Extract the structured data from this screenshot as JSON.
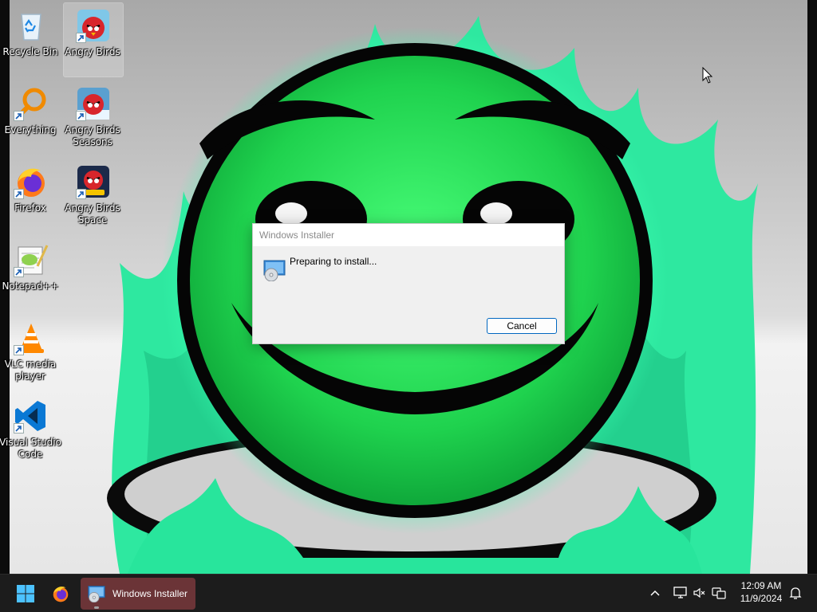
{
  "desktop": {
    "icons": [
      {
        "label": "Recycle Bin",
        "icon": "recycle-bin-icon"
      },
      {
        "label": "Angry Birds",
        "icon": "angry-birds-icon",
        "selected": true
      },
      {
        "label": "Everything",
        "icon": "everything-search-icon"
      },
      {
        "label": "Angry Birds Seasons",
        "icon": "angry-birds-seasons-icon"
      },
      {
        "label": "Firefox",
        "icon": "firefox-icon"
      },
      {
        "label": "Angry Birds Space",
        "icon": "angry-birds-space-icon"
      },
      {
        "label": "Notepad++",
        "icon": "notepad-plus-plus-icon"
      },
      {
        "label": "VLC media player",
        "icon": "vlc-icon"
      },
      {
        "label": "Visual Studio Code",
        "icon": "vscode-icon"
      }
    ]
  },
  "dialog": {
    "title": "Windows Installer",
    "message": "Preparing to install...",
    "cancel_label": "Cancel"
  },
  "taskbar": {
    "active_window_label": "Windows Installer",
    "clock_time": "12:09 AM",
    "clock_date": "11/9/2024"
  },
  "colors": {
    "accent": "#0067c0",
    "wallpaper_green": "#22d35a",
    "taskbar_bg": "#1c1c1c",
    "active_task_bg": "#6b3437"
  }
}
